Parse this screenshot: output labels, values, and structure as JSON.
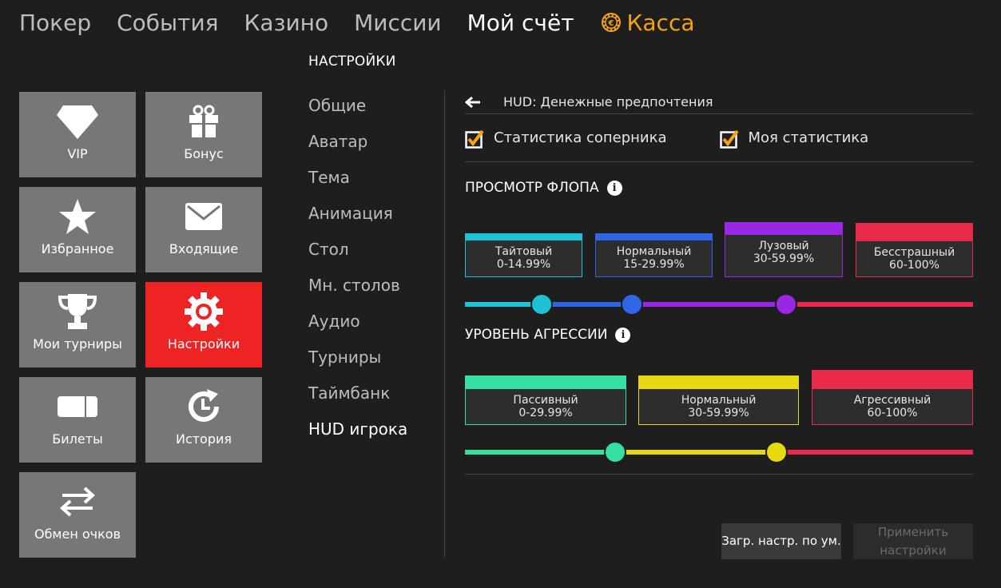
{
  "nav": {
    "items": [
      "Покер",
      "События",
      "Казино",
      "Миссии",
      "Мой счёт"
    ],
    "active": "Мой счёт",
    "cashier": "Касса",
    "cashier_color": "#f2a313"
  },
  "tiles": [
    {
      "label": "VIP",
      "icon": "diamond-icon"
    },
    {
      "label": "Бонус",
      "icon": "gift-icon"
    },
    {
      "label": "Избранное",
      "icon": "star-icon"
    },
    {
      "label": "Входящие",
      "icon": "envelope-icon"
    },
    {
      "label": "Мои турниры",
      "icon": "trophy-icon"
    },
    {
      "label": "Настройки",
      "icon": "gear-icon",
      "active": true
    },
    {
      "label": "Билеты",
      "icon": "ticket-icon"
    },
    {
      "label": "История",
      "icon": "history-icon"
    },
    {
      "label": "Обмен очков",
      "icon": "exchange-icon"
    }
  ],
  "settings": {
    "title": "НАСТРОЙКИ",
    "menu": [
      "Общие",
      "Аватар",
      "Тема",
      "Анимация",
      "Стол",
      "Мн. столов",
      "Аудио",
      "Турниры",
      "Таймбанк",
      "HUD игрока"
    ],
    "active": "HUD игрока"
  },
  "panel": {
    "title": "HUD: Денежные предпочтения",
    "checks": [
      {
        "label": "Статистика соперника",
        "checked": true
      },
      {
        "label": "Моя статистика",
        "checked": true
      }
    ],
    "flop": {
      "title": "ПРОСМОТР ФЛОПА",
      "ranges": [
        {
          "name": "Тайтовый",
          "range": "0-14.99%",
          "color": "#1fc1d6"
        },
        {
          "name": "Нормальный",
          "range": "15-29.99%",
          "color": "#2f66e8"
        },
        {
          "name": "Лузовый",
          "range": "30-59.99%",
          "color": "#9b27e6"
        },
        {
          "name": "Бесстрашный",
          "range": "60-100%",
          "color": "#ea2a4a"
        }
      ],
      "knobs": [
        15,
        30,
        60
      ]
    },
    "aggression": {
      "title": "УРОВЕНЬ АГРЕССИИ",
      "ranges": [
        {
          "name": "Пассивный",
          "range": "0-29.99%",
          "color": "#35e0a0"
        },
        {
          "name": "Нормальный",
          "range": "30-59.99%",
          "color": "#e6d90f"
        },
        {
          "name": "Агрессивный",
          "range": "60-100%",
          "color": "#ea2a4a"
        }
      ],
      "knobs": [
        30,
        60
      ]
    },
    "buttons": {
      "defaults": "Загр. настр. по ум.",
      "apply_line1": "Применить",
      "apply_line2": "настройки"
    },
    "check_color": "#f2a313"
  }
}
